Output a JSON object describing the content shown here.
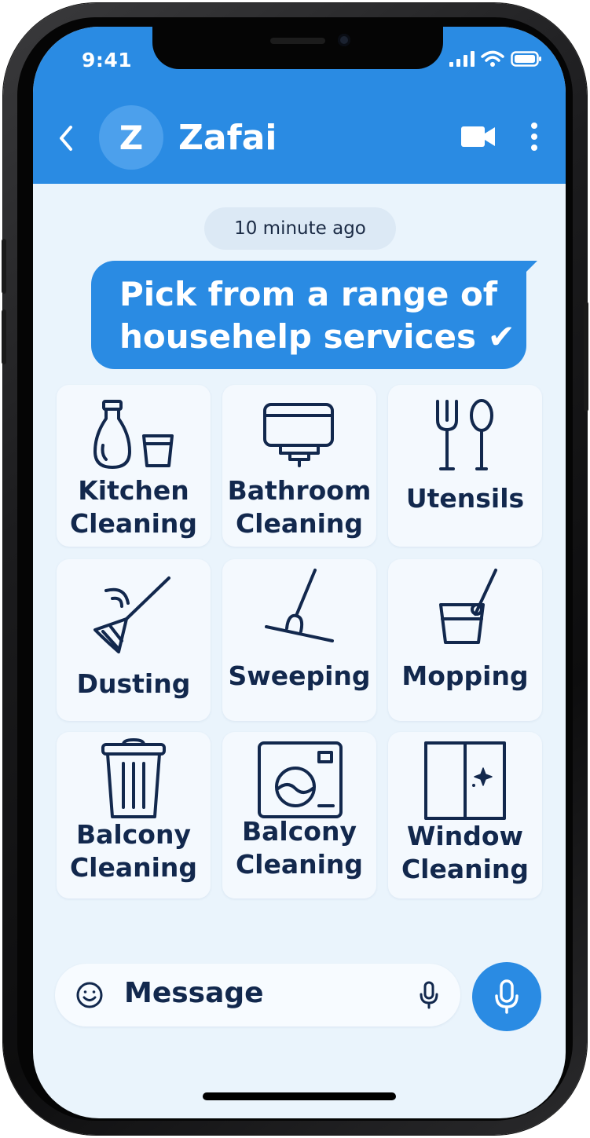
{
  "status_bar": {
    "time": "9:41"
  },
  "header": {
    "avatar_letter": "Z",
    "contact_name": "Zafai"
  },
  "chat": {
    "timestamp": "10 minute ago",
    "message_line1": "Pick from a range of",
    "message_line2": "househelp services",
    "check_glyph": "✔"
  },
  "services": [
    {
      "label": "Kitchen\nCleaning",
      "icon": "kitchen-bottle-glass-icon"
    },
    {
      "label": "Bathroom\nCleaning",
      "icon": "sink-icon"
    },
    {
      "label": "Utensils",
      "icon": "fork-spoon-icon"
    },
    {
      "label": "Dusting",
      "icon": "duster-icon"
    },
    {
      "label": "Sweeping",
      "icon": "broom-icon"
    },
    {
      "label": "Mopping",
      "icon": "mop-bucket-icon"
    },
    {
      "label": "Balcony\nCleaning",
      "icon": "trash-bin-icon"
    },
    {
      "label": "Balcony\nCleaning",
      "icon": "washing-machine-icon"
    },
    {
      "label": "Window\nCleaning",
      "icon": "window-icon"
    }
  ],
  "composer": {
    "placeholder": "Message"
  },
  "colors": {
    "accent": "#2a8be3",
    "text_dark": "#12284d",
    "background": "#eaf4fc"
  }
}
